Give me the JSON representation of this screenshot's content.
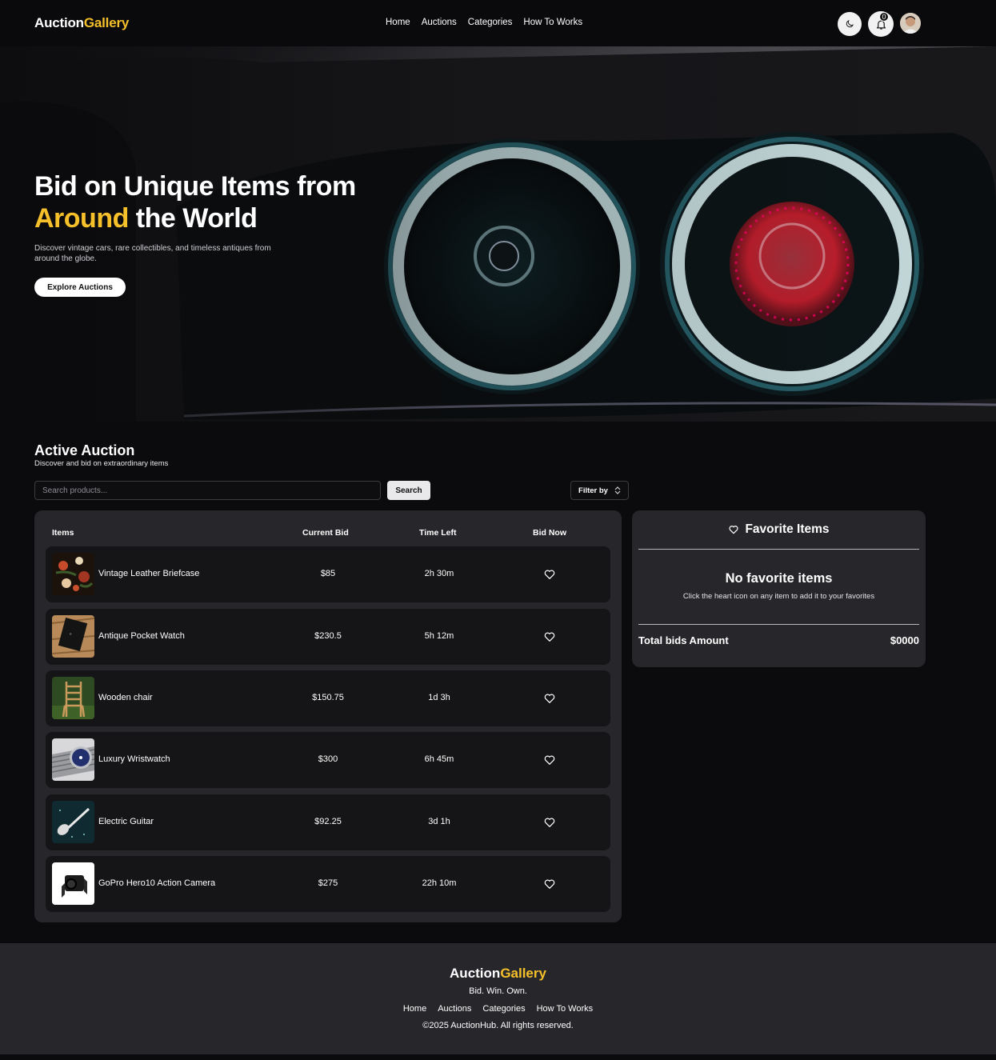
{
  "nav": {
    "logo_main": "Auction",
    "logo_accent": "Gallery",
    "links": [
      "Home",
      "Auctions",
      "Categories",
      "How To Works"
    ],
    "notification_count": "0"
  },
  "hero": {
    "title_line1": "Bid on Unique Items from",
    "title_accent": "Around",
    "title_rest": " the World",
    "subtitle": "Discover vintage cars, rare collectibles, and timeless antiques from around the globe.",
    "cta": "Explore Auctions"
  },
  "auction": {
    "title": "Active Auction",
    "subtitle": "Discover and bid on extraordinary items",
    "search_placeholder": "Search products...",
    "search_button": "Search",
    "filter_label": "Filter by",
    "columns": [
      "Items",
      "Current Bid",
      "Time Left",
      "Bid Now"
    ],
    "items": [
      {
        "name": "Vintage Leather Briefcase",
        "bid": "$85",
        "time": "2h 30m",
        "thumb": "floral-painting"
      },
      {
        "name": "Antique Pocket Watch",
        "bid": "$230.5",
        "time": "5h 12m",
        "thumb": "book-on-wood"
      },
      {
        "name": "Wooden chair",
        "bid": "$150.75",
        "time": "1d 3h",
        "thumb": "chair-in-grass"
      },
      {
        "name": "Luxury Wristwatch",
        "bid": "$300",
        "time": "6h 45m",
        "thumb": "wristwatch"
      },
      {
        "name": "Electric Guitar",
        "bid": "$92.25",
        "time": "3d 1h",
        "thumb": "guitar"
      },
      {
        "name": "GoPro Hero10 Action Camera",
        "bid": "$275",
        "time": "22h 10m",
        "thumb": "camera"
      }
    ]
  },
  "favorites": {
    "title": "Favorite Items",
    "empty_title": "No favorite items",
    "empty_subtitle": "Click the heart icon on any item to add it to your favorites",
    "total_label": "Total bids Amount",
    "total_value": "$0000"
  },
  "footer": {
    "logo_main": "Auction",
    "logo_accent": "Gallery",
    "tagline": "Bid. Win. Own.",
    "links": [
      "Home",
      "Auctions",
      "Categories",
      "How To Works"
    ],
    "copyright": "©2025 AuctionHub. All rights reserved."
  },
  "colors": {
    "accent": "#f5c02a",
    "panel": "#27272b",
    "row": "#151517",
    "background": "#0b0b0d"
  }
}
